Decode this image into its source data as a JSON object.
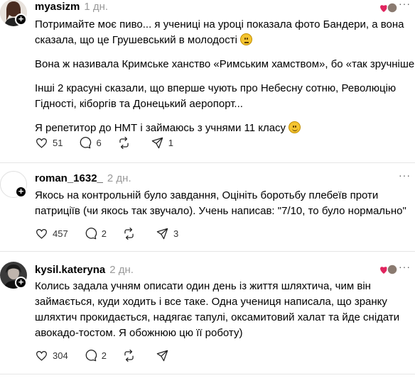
{
  "posts": [
    {
      "username": "myasizm",
      "time": "1 дн.",
      "paragraphs": [
        "Потримайте моє пиво... я учениці на уроці показала фото Бандери, а вона сказала, що це Грушевський в молодості",
        "Вона ж називала Кримське ханство «Римським хамством», бо «так зручніше»",
        "Інші 2 красуні сказали, що вперше чують про Небесну сотню, Революцію Гідності, кіборгів та Донецький аеропорт...",
        "Я репетитор до НМТ і займаюсь з учнями 11 класу"
      ],
      "emoji_1": "neutral-face",
      "emoji_2": "smiling-face",
      "likes": "51",
      "replies": "6",
      "reposts": "",
      "shares": "1"
    },
    {
      "username": "roman_1632_",
      "time": "2 дн.",
      "paragraphs": [
        "Якось на контрольній було завдання, Оцініть боротьбу плебеїв проти патриціїв (чи якось так звучало). Учень написав: \"7/10, то було нормально\""
      ],
      "likes": "457",
      "replies": "2",
      "reposts": "",
      "shares": "3"
    },
    {
      "username": "kysil.kateryna",
      "time": "2 дн.",
      "paragraphs": [
        "Колись задала учням описати один день із життя шляхтича, чим він займається, куди ходить і все таке. Одна учениця написала, що зранку шляхтич прокидається, надягає тапулі, оксамитовий халат та йде снідати авокадо-тостом. Я обожнюю цю її роботу)"
      ],
      "likes": "304",
      "replies": "2",
      "reposts": "",
      "shares": ""
    }
  ],
  "more_label": "···",
  "colors": {
    "heart": "#e0245e",
    "muted": "#999999",
    "divider": "#e6e6e6"
  }
}
